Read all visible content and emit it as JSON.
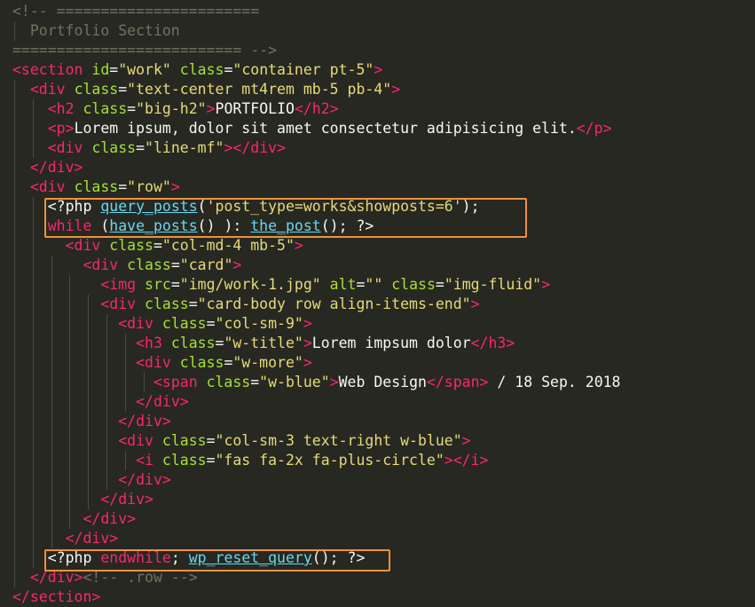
{
  "editor": {
    "background": "#272822",
    "colors": {
      "tag": "#f92672",
      "attribute": "#a6e22e",
      "string": "#e6db74",
      "text": "#f8f8f2",
      "comment": "#75715e",
      "function": "#66d9ef",
      "highlight_box": "#f0923a"
    },
    "lines": [
      [
        {
          "t": "com",
          "v": "<!-- ======================="
        }
      ],
      [
        {
          "t": "com",
          "v": "  Portfolio Section"
        }
      ],
      [
        {
          "t": "com",
          "v": "========================== -->"
        }
      ],
      [
        {
          "t": "tag",
          "v": "<section"
        },
        {
          "t": "pun",
          "v": " "
        },
        {
          "t": "attr",
          "v": "id"
        },
        {
          "t": "pun",
          "v": "="
        },
        {
          "t": "str",
          "v": "\"work\""
        },
        {
          "t": "pun",
          "v": " "
        },
        {
          "t": "attr",
          "v": "class"
        },
        {
          "t": "pun",
          "v": "="
        },
        {
          "t": "str",
          "v": "\"container pt-5\""
        },
        {
          "t": "tag",
          "v": ">"
        }
      ],
      [
        {
          "t": "pun",
          "v": "  "
        },
        {
          "t": "tag",
          "v": "<div"
        },
        {
          "t": "pun",
          "v": " "
        },
        {
          "t": "attr",
          "v": "class"
        },
        {
          "t": "pun",
          "v": "="
        },
        {
          "t": "str",
          "v": "\"text-center mt4rem mb-5 pb-4\""
        },
        {
          "t": "tag",
          "v": ">"
        }
      ],
      [
        {
          "t": "pun",
          "v": "    "
        },
        {
          "t": "tag",
          "v": "<h2"
        },
        {
          "t": "pun",
          "v": " "
        },
        {
          "t": "attr",
          "v": "class"
        },
        {
          "t": "pun",
          "v": "="
        },
        {
          "t": "str",
          "v": "\"big-h2\""
        },
        {
          "t": "tag",
          "v": ">"
        },
        {
          "t": "txt",
          "v": "PORTFOLIO"
        },
        {
          "t": "tag",
          "v": "</h2>"
        }
      ],
      [
        {
          "t": "pun",
          "v": "    "
        },
        {
          "t": "tag",
          "v": "<p>"
        },
        {
          "t": "txt",
          "v": "Lorem ipsum, dolor sit amet consectetur adipisicing elit."
        },
        {
          "t": "tag",
          "v": "</p>"
        }
      ],
      [
        {
          "t": "pun",
          "v": "    "
        },
        {
          "t": "tag",
          "v": "<div"
        },
        {
          "t": "pun",
          "v": " "
        },
        {
          "t": "attr",
          "v": "class"
        },
        {
          "t": "pun",
          "v": "="
        },
        {
          "t": "str",
          "v": "\"line-mf\""
        },
        {
          "t": "tag",
          "v": "></div>"
        }
      ],
      [
        {
          "t": "pun",
          "v": "  "
        },
        {
          "t": "tag",
          "v": "</div>"
        }
      ],
      [
        {
          "t": "pun",
          "v": "  "
        },
        {
          "t": "tag",
          "v": "<div"
        },
        {
          "t": "pun",
          "v": " "
        },
        {
          "t": "attr",
          "v": "class"
        },
        {
          "t": "pun",
          "v": "="
        },
        {
          "t": "str",
          "v": "\"row\""
        },
        {
          "t": "tag",
          "v": ">"
        }
      ],
      [
        {
          "t": "pun",
          "v": "    "
        },
        {
          "t": "pun",
          "v": "<?php "
        },
        {
          "t": "fn",
          "v": "query_posts"
        },
        {
          "t": "pun",
          "v": "("
        },
        {
          "t": "str",
          "v": "'post_type=works&showposts=6'"
        },
        {
          "t": "pun",
          "v": ");"
        }
      ],
      [
        {
          "t": "pun",
          "v": "    "
        },
        {
          "t": "kw",
          "v": "while"
        },
        {
          "t": "pun",
          "v": " ("
        },
        {
          "t": "fn",
          "v": "have_posts"
        },
        {
          "t": "pun",
          "v": "() ): "
        },
        {
          "t": "fn",
          "v": "the_post"
        },
        {
          "t": "pun",
          "v": "(); ?>"
        }
      ],
      [
        {
          "t": "pun",
          "v": "      "
        },
        {
          "t": "tag",
          "v": "<div"
        },
        {
          "t": "pun",
          "v": " "
        },
        {
          "t": "attr",
          "v": "class"
        },
        {
          "t": "pun",
          "v": "="
        },
        {
          "t": "str",
          "v": "\"col-md-4 mb-5\""
        },
        {
          "t": "tag",
          "v": ">"
        }
      ],
      [
        {
          "t": "pun",
          "v": "        "
        },
        {
          "t": "tag",
          "v": "<div"
        },
        {
          "t": "pun",
          "v": " "
        },
        {
          "t": "attr",
          "v": "class"
        },
        {
          "t": "pun",
          "v": "="
        },
        {
          "t": "str",
          "v": "\"card\""
        },
        {
          "t": "tag",
          "v": ">"
        }
      ],
      [
        {
          "t": "pun",
          "v": "          "
        },
        {
          "t": "tag",
          "v": "<img"
        },
        {
          "t": "pun",
          "v": " "
        },
        {
          "t": "attr",
          "v": "src"
        },
        {
          "t": "pun",
          "v": "="
        },
        {
          "t": "str",
          "v": "\"img/work-1.jpg\""
        },
        {
          "t": "pun",
          "v": " "
        },
        {
          "t": "attr",
          "v": "alt"
        },
        {
          "t": "pun",
          "v": "="
        },
        {
          "t": "str",
          "v": "\"\""
        },
        {
          "t": "pun",
          "v": " "
        },
        {
          "t": "attr",
          "v": "class"
        },
        {
          "t": "pun",
          "v": "="
        },
        {
          "t": "str",
          "v": "\"img-fluid\""
        },
        {
          "t": "tag",
          "v": ">"
        }
      ],
      [
        {
          "t": "pun",
          "v": "          "
        },
        {
          "t": "tag",
          "v": "<div"
        },
        {
          "t": "pun",
          "v": " "
        },
        {
          "t": "attr",
          "v": "class"
        },
        {
          "t": "pun",
          "v": "="
        },
        {
          "t": "str",
          "v": "\"card-body row align-items-end\""
        },
        {
          "t": "tag",
          "v": ">"
        }
      ],
      [
        {
          "t": "pun",
          "v": "            "
        },
        {
          "t": "tag",
          "v": "<div"
        },
        {
          "t": "pun",
          "v": " "
        },
        {
          "t": "attr",
          "v": "class"
        },
        {
          "t": "pun",
          "v": "="
        },
        {
          "t": "str",
          "v": "\"col-sm-9\""
        },
        {
          "t": "tag",
          "v": ">"
        }
      ],
      [
        {
          "t": "pun",
          "v": "              "
        },
        {
          "t": "tag",
          "v": "<h3"
        },
        {
          "t": "pun",
          "v": " "
        },
        {
          "t": "attr",
          "v": "class"
        },
        {
          "t": "pun",
          "v": "="
        },
        {
          "t": "str",
          "v": "\"w-title\""
        },
        {
          "t": "tag",
          "v": ">"
        },
        {
          "t": "txt",
          "v": "Lorem impsum dolor"
        },
        {
          "t": "tag",
          "v": "</h3>"
        }
      ],
      [
        {
          "t": "pun",
          "v": "              "
        },
        {
          "t": "tag",
          "v": "<div"
        },
        {
          "t": "pun",
          "v": " "
        },
        {
          "t": "attr",
          "v": "class"
        },
        {
          "t": "pun",
          "v": "="
        },
        {
          "t": "str",
          "v": "\"w-more\""
        },
        {
          "t": "tag",
          "v": ">"
        }
      ],
      [
        {
          "t": "pun",
          "v": "                "
        },
        {
          "t": "tag",
          "v": "<span"
        },
        {
          "t": "pun",
          "v": " "
        },
        {
          "t": "attr",
          "v": "class"
        },
        {
          "t": "pun",
          "v": "="
        },
        {
          "t": "str",
          "v": "\"w-blue\""
        },
        {
          "t": "tag",
          "v": ">"
        },
        {
          "t": "txt",
          "v": "Web Design"
        },
        {
          "t": "tag",
          "v": "</span>"
        },
        {
          "t": "txt",
          "v": " / 18 Sep. 2018"
        }
      ],
      [
        {
          "t": "pun",
          "v": "              "
        },
        {
          "t": "tag",
          "v": "</div>"
        }
      ],
      [
        {
          "t": "pun",
          "v": "            "
        },
        {
          "t": "tag",
          "v": "</div>"
        }
      ],
      [
        {
          "t": "pun",
          "v": "            "
        },
        {
          "t": "tag",
          "v": "<div"
        },
        {
          "t": "pun",
          "v": " "
        },
        {
          "t": "attr",
          "v": "class"
        },
        {
          "t": "pun",
          "v": "="
        },
        {
          "t": "str",
          "v": "\"col-sm-3 text-right w-blue\""
        },
        {
          "t": "tag",
          "v": ">"
        }
      ],
      [
        {
          "t": "pun",
          "v": "              "
        },
        {
          "t": "tag",
          "v": "<i"
        },
        {
          "t": "pun",
          "v": " "
        },
        {
          "t": "attr",
          "v": "class"
        },
        {
          "t": "pun",
          "v": "="
        },
        {
          "t": "str",
          "v": "\"fas fa-2x fa-plus-circle\""
        },
        {
          "t": "tag",
          "v": "></i>"
        }
      ],
      [
        {
          "t": "pun",
          "v": "            "
        },
        {
          "t": "tag",
          "v": "</div>"
        }
      ],
      [
        {
          "t": "pun",
          "v": "          "
        },
        {
          "t": "tag",
          "v": "</div>"
        }
      ],
      [
        {
          "t": "pun",
          "v": "        "
        },
        {
          "t": "tag",
          "v": "</div>"
        }
      ],
      [
        {
          "t": "pun",
          "v": "      "
        },
        {
          "t": "tag",
          "v": "</div>"
        }
      ],
      [
        {
          "t": "pun",
          "v": "    "
        },
        {
          "t": "pun",
          "v": "<?php "
        },
        {
          "t": "kw",
          "v": "endwhile"
        },
        {
          "t": "pun",
          "v": "; "
        },
        {
          "t": "fn",
          "v": "wp_reset_query"
        },
        {
          "t": "pun",
          "v": "(); ?>"
        }
      ],
      [
        {
          "t": "pun",
          "v": "  "
        },
        {
          "t": "tag",
          "v": "</div>"
        },
        {
          "t": "com",
          "v": "<!-- .row -->"
        }
      ],
      [
        {
          "t": "tag",
          "v": "</section>"
        }
      ]
    ]
  }
}
